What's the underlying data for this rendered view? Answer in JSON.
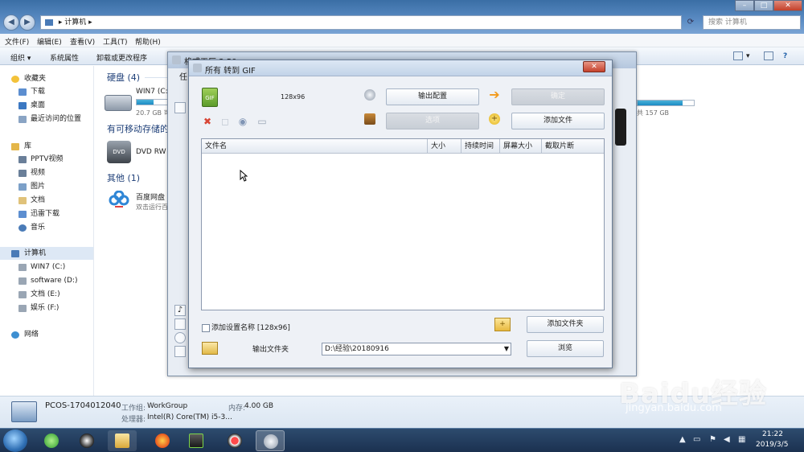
{
  "explorer": {
    "address": "计算机",
    "search_placeholder": "搜索 计算机",
    "menu": [
      "文件(F)",
      "编辑(E)",
      "查看(V)",
      "工具(T)",
      "帮助(H)"
    ],
    "toolbar": [
      "组织 ▾",
      "系统属性",
      "卸载或更改程序"
    ],
    "sidebar": {
      "favorites": "收藏夹",
      "fav_items": [
        "下载",
        "桌面",
        "最近访问的位置"
      ],
      "library": "库",
      "lib_items": [
        "PPTV视频",
        "视频",
        "图片",
        "文档",
        "迅雷下载",
        "音乐"
      ],
      "computer": "计算机",
      "drives": [
        "WIN7 (C:)",
        "software (D:)",
        "文档 (E:)",
        "娱乐 (F:)"
      ],
      "network": "网络"
    },
    "content": {
      "hdd_header": "硬盘 (4)",
      "c_drive_name": "WIN7 (C:)",
      "c_drive_free": "20.7 GB 可",
      "c_drive_usage": 0.55,
      "other_drive_free": "共 157 GB",
      "other_drive_usage": 0.8,
      "removable_header": "有可移动存储的",
      "dvd_name": "DVD RW",
      "other_header": "其他 (1)",
      "baidu_name": "百度网盘",
      "baidu_sub": "双击运行百"
    },
    "details": {
      "pc_name": "PCOS-1704012040",
      "workgroup_label": "工作组:",
      "workgroup": "WorkGroup",
      "memory_label": "内存:",
      "memory": "4.00 GB",
      "cpu_label": "处理器:",
      "cpu": "Intel(R) Core(TM) i5-3..."
    }
  },
  "ff_back": {
    "title": "格式工厂 3.50",
    "tab": "任"
  },
  "dialog": {
    "title": "所有 转到 GIF",
    "size_label": "128x96",
    "output_config": "输出配置",
    "ok": "确定",
    "options": "选项",
    "add_file": "添加文件",
    "columns": [
      "文件名",
      "大小",
      "持续时间",
      "屏幕大小",
      "截取片断"
    ],
    "add_setting_name": "添加设置名称 [128x96]",
    "add_folder": "添加文件夹",
    "output_folder_label": "输出文件夹",
    "output_folder_value": "D:\\经验\\20180916",
    "browse": "浏览"
  },
  "taskbar": {
    "time": "21:22",
    "date": "2019/3/5"
  },
  "watermark": {
    "main": "Baidu经验",
    "sub": "jingyan.baidu.com"
  },
  "colors": {
    "accent": "#1b8bc4",
    "close_red": "#c5412c",
    "taskbar": "#1b3150"
  }
}
